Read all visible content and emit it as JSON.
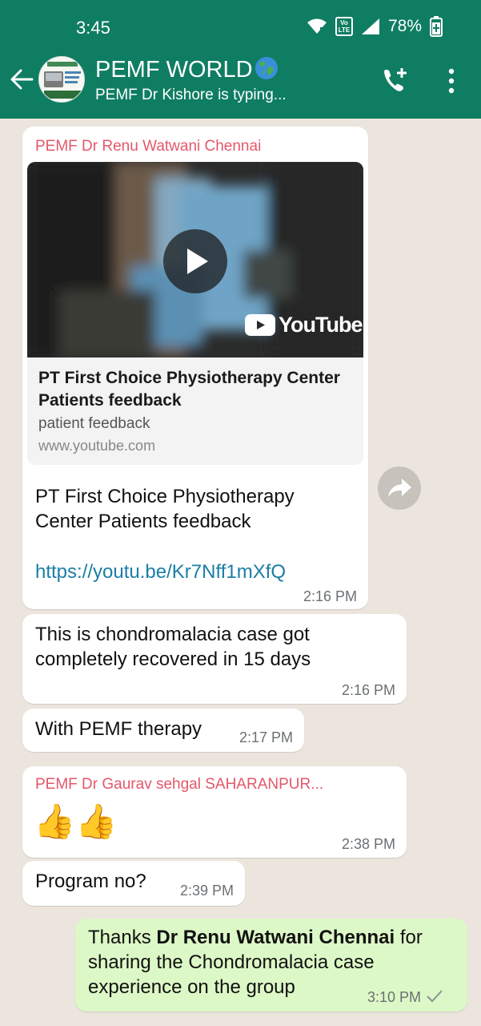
{
  "status_bar": {
    "time": "3:45",
    "network_badge": "VoLTE",
    "battery": "78%"
  },
  "header": {
    "title": "PEMF WORLD",
    "status": "PEMF Dr Kishore is typing...",
    "icons": [
      "back-arrow-icon",
      "group-avatar",
      "globe-emoji",
      "add-call-icon",
      "more-options-icon"
    ]
  },
  "messages": [
    {
      "sender": "PEMF Dr Renu Watwani Chennai",
      "link_preview": {
        "brand": "YouTube",
        "title": "PT First Choice Physiotherapy Center Patients feedback",
        "description": "patient feedback",
        "domain": "www.youtube.com"
      },
      "text": "PT First Choice Physiotherapy Center Patients feedback",
      "link": "https://youtu.be/Kr7Nff1mXfQ",
      "time": "2:16 PM"
    },
    {
      "text": "This is chondromalacia case got completely recovered in 15 days",
      "time": "2:16 PM"
    },
    {
      "text": "With PEMF therapy",
      "time": "2:17 PM"
    },
    {
      "sender": "PEMF Dr Gaurav sehgal SAHARANPUR...",
      "text": "👍👍",
      "time": "2:38 PM"
    },
    {
      "text": "Program no?",
      "time": "2:39 PM"
    },
    {
      "outgoing": true,
      "text_before": "Thanks ",
      "mention": "Dr Renu Watwani Chennai",
      "text_after": " for sharing the Chondromalacia case experience on the group",
      "time": "3:10 PM",
      "delivery": "single-check-icon"
    }
  ],
  "colors": {
    "header": "#0f7d62",
    "chat_bg": "#ece5dd",
    "incoming": "#ffffff",
    "outgoing": "#dcf8c6",
    "sender_name": "#e4576a",
    "link": "#1b7ea6"
  }
}
